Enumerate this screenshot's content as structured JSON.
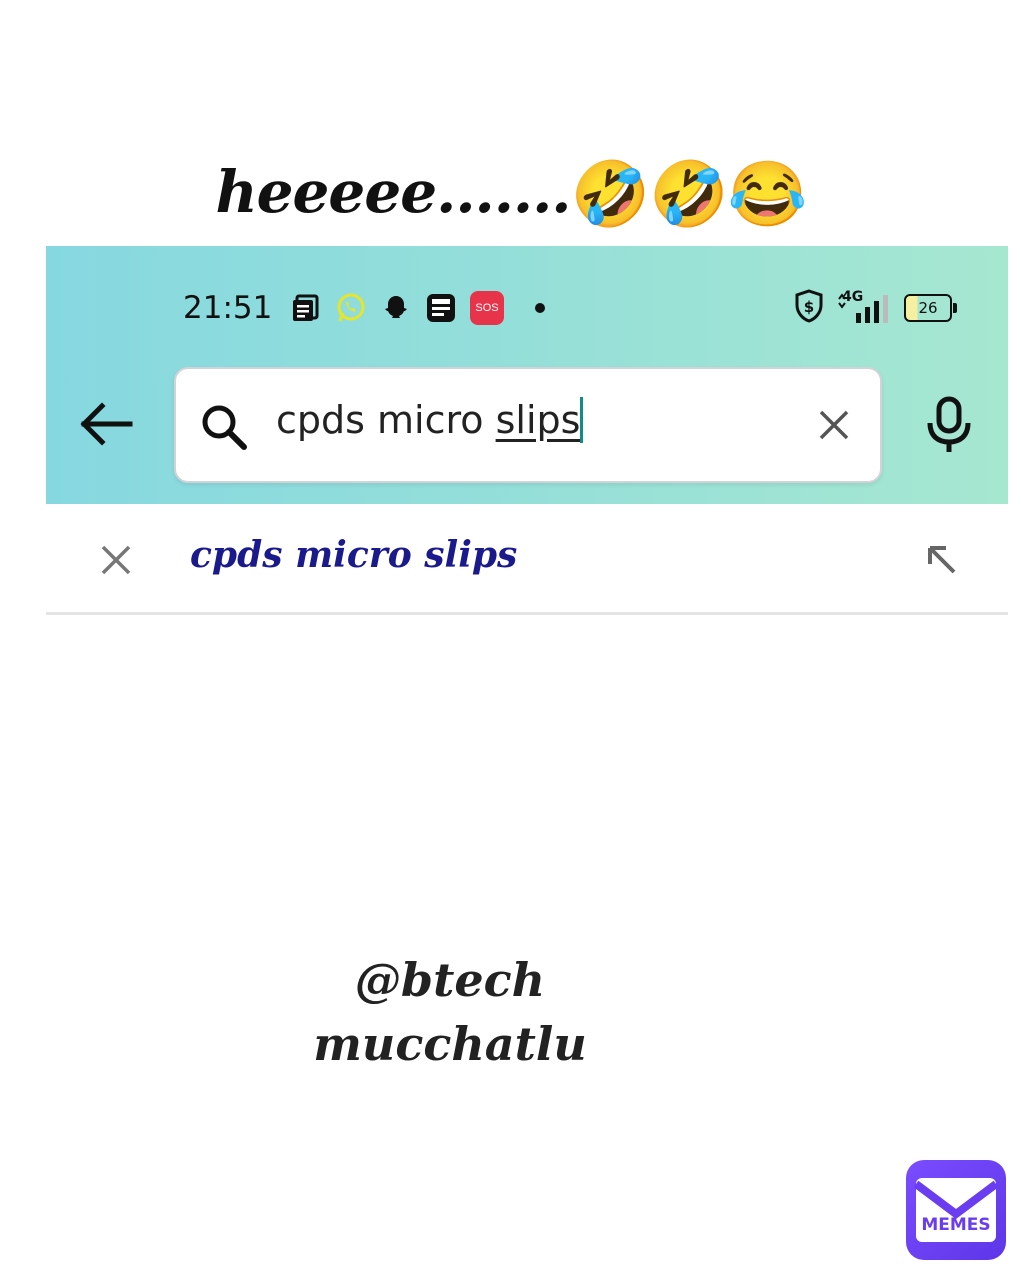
{
  "caption": {
    "text": "heeeee.......",
    "emojis": [
      "🤣",
      "🤣",
      "😂"
    ]
  },
  "status_bar": {
    "time": "21:51",
    "icons": [
      "news-icon",
      "whatsapp-icon",
      "snapchat-icon",
      "notes-app-icon",
      "sos-icon"
    ],
    "sos_label": "SOS",
    "network": "4G",
    "battery_level": "26"
  },
  "search": {
    "query_prefix": "cpds micro ",
    "query_underlined": "slips"
  },
  "suggestions": [
    {
      "text": "cpds micro slips"
    }
  ],
  "watermark": {
    "line1": "@btech",
    "line2": "mucchatlu"
  },
  "logo": {
    "label": "MEMES"
  },
  "colors": {
    "accent_cyan": "#86d8e0",
    "accent_mint": "#a6e7d0",
    "suggestion_text": "#1a1a8c",
    "caret": "#0e8f86",
    "logo_purple": "#6a3ef0"
  }
}
